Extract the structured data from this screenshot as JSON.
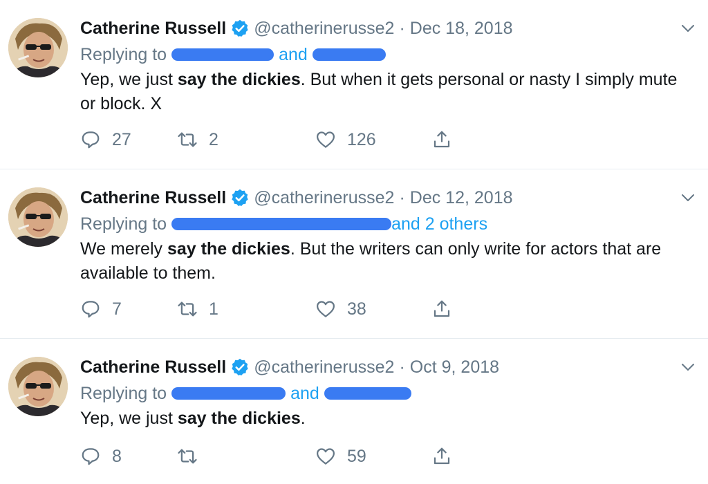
{
  "colors": {
    "accent": "#1da1f2",
    "text": "#14171a",
    "secondary": "#657786",
    "redaction": "#3a7bf2",
    "divider": "#e6ecf0"
  },
  "tweets": [
    {
      "display_name": "Catherine Russell",
      "handle": "@catherinerusse2",
      "separator": "·",
      "date": "Dec 18, 2018",
      "replying_prefix": "Replying to",
      "replying_joiner": "and",
      "replying_suffix": "",
      "text_before": "Yep, we just ",
      "text_bold": "say the dickies",
      "text_after": ". But when it gets personal or nasty I simply mute or block. X",
      "replies": "27",
      "retweets": "2",
      "likes": "126"
    },
    {
      "display_name": "Catherine Russell",
      "handle": "@catherinerusse2",
      "separator": "·",
      "date": "Dec 12, 2018",
      "replying_prefix": "Replying to",
      "replying_joiner": "",
      "replying_suffix": "and 2 others",
      "text_before": "We merely ",
      "text_bold": "say the dickies",
      "text_after": ". But the writers can only write for actors that are available to them.",
      "replies": "7",
      "retweets": "1",
      "likes": "38"
    },
    {
      "display_name": "Catherine Russell",
      "handle": "@catherinerusse2",
      "separator": "·",
      "date": "Oct 9, 2018",
      "replying_prefix": "Replying to",
      "replying_joiner": "and",
      "replying_suffix": "",
      "text_before": "Yep, we just ",
      "text_bold": "say the dickies",
      "text_after": ".",
      "replies": "8",
      "retweets": "",
      "likes": "59"
    }
  ],
  "icons": {
    "verified": "verified-badge-icon",
    "caret": "chevron-down-icon",
    "reply": "reply-icon",
    "retweet": "retweet-icon",
    "like": "heart-icon",
    "share": "share-icon"
  }
}
